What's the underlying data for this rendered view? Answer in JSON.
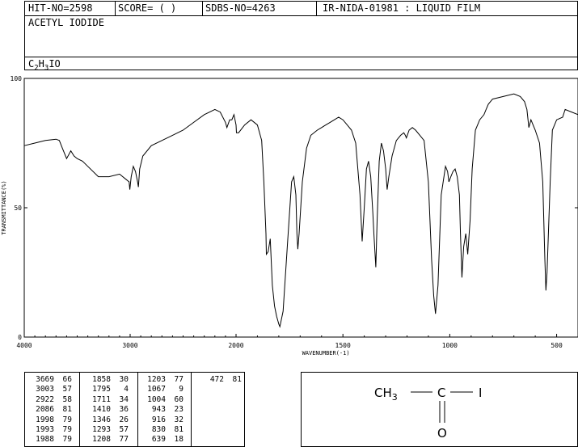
{
  "header": {
    "hit_no": "HIT-NO=2598",
    "score": "SCORE=  (  )",
    "sdbs_no": "SDBS-NO=4263",
    "method": "IR-NIDA-01981 : LIQUID FILM",
    "compound_name": "ACETYL IODIDE",
    "formula_parts": [
      "C",
      "2",
      "H",
      "3",
      "IO"
    ]
  },
  "chart_data": {
    "type": "line",
    "title": "",
    "xlabel": "WAVENUMBER(-1)",
    "ylabel": "TRANSMITTANCE(%)",
    "xlim": [
      4000,
      400
    ],
    "ylim": [
      0,
      100
    ],
    "x_ticks": [
      4000,
      3000,
      2000,
      1500,
      1000,
      500
    ],
    "y_ticks": [
      0,
      50,
      100
    ],
    "grid": false,
    "series": [
      {
        "x": [
          4000,
          3900,
          3800,
          3700,
          3669,
          3640,
          3600,
          3560,
          3530,
          3500,
          3450,
          3400,
          3300,
          3200,
          3100,
          3040,
          3010,
          3003,
          2990,
          2970,
          2950,
          2930,
          2922,
          2910,
          2880,
          2800,
          2700,
          2600,
          2500,
          2400,
          2300,
          2200,
          2150,
          2100,
          2086,
          2060,
          2040,
          2020,
          2000,
          1998,
          1993,
          1988,
          1960,
          1930,
          1900,
          1880,
          1870,
          1860,
          1858,
          1850,
          1840,
          1830,
          1820,
          1810,
          1800,
          1795,
          1780,
          1760,
          1740,
          1730,
          1720,
          1715,
          1711,
          1705,
          1690,
          1670,
          1650,
          1620,
          1600,
          1580,
          1560,
          1540,
          1520,
          1500,
          1480,
          1460,
          1440,
          1420,
          1410,
          1400,
          1390,
          1380,
          1370,
          1360,
          1355,
          1346,
          1340,
          1330,
          1320,
          1310,
          1300,
          1293,
          1285,
          1270,
          1250,
          1230,
          1215,
          1208,
          1203,
          1190,
          1175,
          1160,
          1140,
          1120,
          1100,
          1085,
          1075,
          1067,
          1055,
          1040,
          1020,
          1010,
          1004,
          995,
          985,
          975,
          965,
          955,
          950,
          943,
          935,
          925,
          916,
          905,
          895,
          880,
          860,
          840,
          830,
          820,
          800,
          750,
          700,
          670,
          650,
          639,
          630,
          620,
          600,
          580,
          565,
          555,
          550,
          545,
          530,
          520,
          500,
          472,
          460,
          430,
          400
        ],
        "y": [
          74,
          75,
          76,
          76.5,
          76,
          73,
          69,
          72,
          70,
          69,
          68,
          66,
          62,
          62,
          63,
          61,
          60,
          57,
          62,
          66,
          64,
          60,
          58,
          65,
          70,
          74,
          76,
          78,
          80,
          83,
          86,
          88,
          87,
          83,
          81,
          84,
          84,
          86,
          82,
          79,
          79,
          79,
          82,
          84,
          82,
          76,
          60,
          40,
          32,
          33,
          38,
          20,
          12,
          8,
          5,
          4,
          10,
          35,
          60,
          62,
          55,
          40,
          34,
          40,
          60,
          73,
          78,
          80,
          81,
          82,
          83,
          84,
          85,
          84,
          82,
          80,
          75,
          55,
          37,
          50,
          65,
          68,
          62,
          48,
          40,
          27,
          45,
          68,
          75,
          72,
          65,
          57,
          62,
          70,
          76,
          78,
          79,
          78,
          77,
          80,
          81,
          80,
          78,
          76,
          60,
          30,
          16,
          9,
          20,
          55,
          66,
          64,
          60,
          62,
          64,
          65,
          62,
          55,
          40,
          23,
          35,
          40,
          32,
          45,
          65,
          80,
          84,
          86,
          88,
          90,
          92,
          93,
          94,
          93,
          91,
          88,
          81,
          84,
          80,
          75,
          60,
          30,
          18,
          25,
          60,
          80,
          84,
          85,
          88,
          87,
          86
        ]
      }
    ],
    "peaks": [
      [
        3669,
        66
      ],
      [
        3003,
        57
      ],
      [
        2922,
        58
      ],
      [
        2086,
        81
      ],
      [
        1998,
        79
      ],
      [
        1993,
        79
      ],
      [
        1988,
        79
      ],
      [
        1858,
        30
      ],
      [
        1795,
        4
      ],
      [
        1711,
        34
      ],
      [
        1410,
        36
      ],
      [
        1346,
        26
      ],
      [
        1293,
        57
      ],
      [
        1208,
        77
      ],
      [
        1203,
        77
      ],
      [
        1067,
        9
      ],
      [
        1004,
        60
      ],
      [
        943,
        23
      ],
      [
        916,
        32
      ],
      [
        830,
        81
      ],
      [
        639,
        18
      ],
      [
        472,
        81
      ]
    ]
  },
  "structure": {
    "left": "CH",
    "left_sub": "3",
    "center": "C",
    "right": "I",
    "bottom": "O"
  }
}
